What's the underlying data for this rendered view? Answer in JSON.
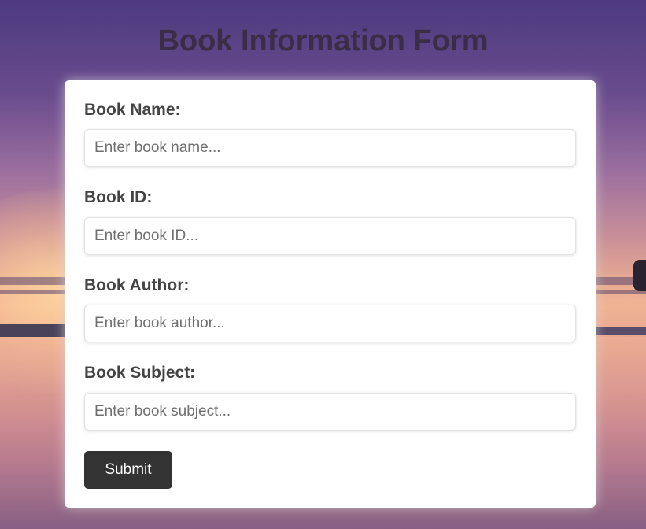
{
  "page": {
    "title": "Book Information Form"
  },
  "form": {
    "fields": [
      {
        "label": "Book Name:",
        "placeholder": "Enter book name...",
        "value": ""
      },
      {
        "label": "Book ID:",
        "placeholder": "Enter book ID...",
        "value": ""
      },
      {
        "label": "Book Author:",
        "placeholder": "Enter book author...",
        "value": ""
      },
      {
        "label": "Book Subject:",
        "placeholder": "Enter book subject...",
        "value": ""
      }
    ],
    "submit_label": "Submit"
  },
  "colors": {
    "title_text": "#3b2d45",
    "label_text": "#444444",
    "button_bg": "#333333",
    "button_text": "#ffffff",
    "card_bg": "#ffffff"
  }
}
